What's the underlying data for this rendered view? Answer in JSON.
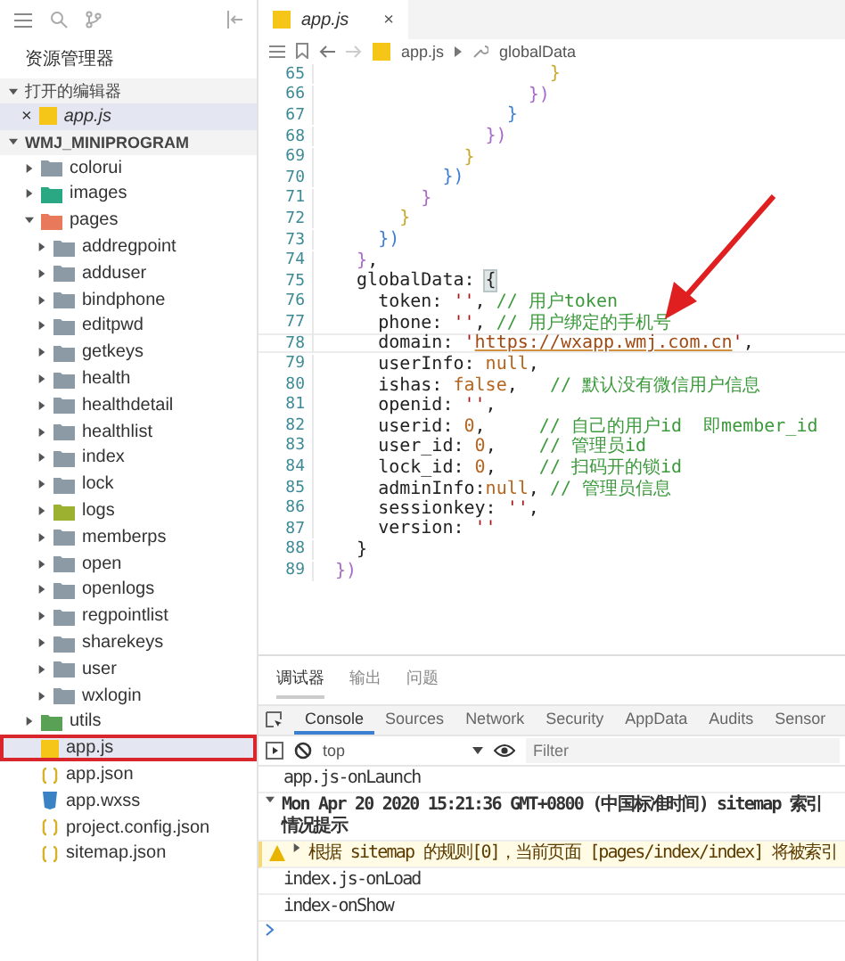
{
  "sidebar": {
    "title": "资源管理器",
    "open_editors": {
      "label": "打开的编辑器",
      "expanded": true,
      "items": [
        {
          "close": "×",
          "name": "app.js",
          "selected": true,
          "preview": true
        }
      ]
    },
    "project": {
      "label": "WMJ_MINIPROGRAM",
      "expanded": true,
      "items": [
        {
          "kind": "folder",
          "name": "colorui",
          "expanded": false
        },
        {
          "kind": "imagefolder",
          "name": "images",
          "expanded": false
        },
        {
          "kind": "pagefolder",
          "name": "pages",
          "expanded": true,
          "children": [
            {
              "kind": "folder",
              "name": "addregpoint",
              "expanded": false
            },
            {
              "kind": "folder",
              "name": "adduser",
              "expanded": false
            },
            {
              "kind": "folder",
              "name": "bindphone",
              "expanded": false
            },
            {
              "kind": "folder",
              "name": "editpwd",
              "expanded": false
            },
            {
              "kind": "folder",
              "name": "getkeys",
              "expanded": false
            },
            {
              "kind": "folder",
              "name": "health",
              "expanded": false
            },
            {
              "kind": "folder",
              "name": "healthdetail",
              "expanded": false
            },
            {
              "kind": "folder",
              "name": "healthlist",
              "expanded": false
            },
            {
              "kind": "folder",
              "name": "index",
              "expanded": false
            },
            {
              "kind": "folder",
              "name": "lock",
              "expanded": false
            },
            {
              "kind": "logfolder",
              "name": "logs",
              "expanded": false
            },
            {
              "kind": "folder",
              "name": "memberps",
              "expanded": false
            },
            {
              "kind": "folder",
              "name": "open",
              "expanded": false
            },
            {
              "kind": "folder",
              "name": "openlogs",
              "expanded": false
            },
            {
              "kind": "folder",
              "name": "regpointlist",
              "expanded": false
            },
            {
              "kind": "folder",
              "name": "sharekeys",
              "expanded": false
            },
            {
              "kind": "folder",
              "name": "user",
              "expanded": false
            },
            {
              "kind": "folder",
              "name": "wxlogin",
              "expanded": false
            }
          ]
        },
        {
          "kind": "utilfolder",
          "name": "utils",
          "expanded": false
        },
        {
          "kind": "jsfile",
          "name": "app.js",
          "selected": true,
          "annotated": true
        },
        {
          "kind": "jsonfile",
          "name": "app.json",
          "selected": false,
          "annotated": false
        },
        {
          "kind": "cssfile",
          "name": "app.wxss",
          "selected": false,
          "annotated": false
        },
        {
          "kind": "jsonfile",
          "name": "project.config.json",
          "selected": false,
          "annotated": false
        },
        {
          "kind": "jsonfile",
          "name": "sitemap.json",
          "selected": false,
          "annotated": false
        }
      ]
    }
  },
  "editor": {
    "tabs": [
      {
        "label": "app.js",
        "close": "×",
        "selected": true
      }
    ],
    "breadcrumb": [
      "app.js",
      "globalData"
    ],
    "lines": [
      {
        "number": "65",
        "current": false,
        "tokens": [
          {
            "kind": "b1",
            "text": "                    }"
          }
        ]
      },
      {
        "number": "66",
        "current": false,
        "tokens": [
          {
            "kind": "b2",
            "text": "                  })"
          }
        ]
      },
      {
        "number": "67",
        "current": false,
        "tokens": [
          {
            "kind": "b3",
            "text": "                }"
          }
        ]
      },
      {
        "number": "68",
        "current": false,
        "tokens": [
          {
            "kind": "b2",
            "text": "              })"
          }
        ]
      },
      {
        "number": "69",
        "current": false,
        "tokens": [
          {
            "kind": "b1",
            "text": "            }"
          }
        ]
      },
      {
        "number": "70",
        "current": false,
        "tokens": [
          {
            "kind": "b3",
            "text": "          })"
          }
        ]
      },
      {
        "number": "71",
        "current": false,
        "tokens": [
          {
            "kind": "b2",
            "text": "        }"
          }
        ]
      },
      {
        "number": "72",
        "current": false,
        "tokens": [
          {
            "kind": "b1",
            "text": "      }"
          }
        ]
      },
      {
        "number": "73",
        "current": false,
        "tokens": [
          {
            "kind": "b3",
            "text": "    })"
          }
        ]
      },
      {
        "number": "74",
        "current": false,
        "tokens": [
          {
            "kind": "b2",
            "text": "  }"
          },
          {
            "kind": "text",
            "text": ","
          }
        ]
      },
      {
        "number": "75",
        "current": false,
        "tokens": [
          {
            "kind": "text",
            "text": "  globalData: "
          },
          {
            "kind": "match",
            "text": "{"
          }
        ]
      },
      {
        "number": "76",
        "current": false,
        "tokens": [
          {
            "kind": "text",
            "text": "    token: "
          },
          {
            "kind": "string",
            "text": "''"
          },
          {
            "kind": "text",
            "text": ", "
          },
          {
            "kind": "comment",
            "text": "// 用户token"
          }
        ]
      },
      {
        "number": "77",
        "current": false,
        "tokens": [
          {
            "kind": "text",
            "text": "    phone: "
          },
          {
            "kind": "string",
            "text": "''"
          },
          {
            "kind": "text",
            "text": ", "
          },
          {
            "kind": "comment",
            "text": "// 用户绑定的手机号"
          }
        ]
      },
      {
        "number": "78",
        "current": true,
        "tokens": [
          {
            "kind": "text",
            "text": "    domain: "
          },
          {
            "kind": "string",
            "text": "'"
          },
          {
            "kind": "link",
            "text": "https://wxapp.wmj.com.cn"
          },
          {
            "kind": "string",
            "text": "'"
          },
          {
            "kind": "text",
            "text": ","
          }
        ]
      },
      {
        "number": "79",
        "current": false,
        "tokens": [
          {
            "kind": "text",
            "text": "    userInfo: "
          },
          {
            "kind": "value",
            "text": "null"
          },
          {
            "kind": "text",
            "text": ","
          }
        ]
      },
      {
        "number": "80",
        "current": false,
        "tokens": [
          {
            "kind": "text",
            "text": "    ishas: "
          },
          {
            "kind": "value",
            "text": "false"
          },
          {
            "kind": "text",
            "text": ",   "
          },
          {
            "kind": "comment",
            "text": "// 默认没有微信用户信息"
          }
        ]
      },
      {
        "number": "81",
        "current": false,
        "tokens": [
          {
            "kind": "text",
            "text": "    openid: "
          },
          {
            "kind": "string",
            "text": "''"
          },
          {
            "kind": "text",
            "text": ","
          }
        ]
      },
      {
        "number": "82",
        "current": false,
        "tokens": [
          {
            "kind": "text",
            "text": "    userid: "
          },
          {
            "kind": "value",
            "text": "0"
          },
          {
            "kind": "text",
            "text": ",     "
          },
          {
            "kind": "comment",
            "text": "// 自己的用户id  即member_id"
          }
        ]
      },
      {
        "number": "83",
        "current": false,
        "tokens": [
          {
            "kind": "text",
            "text": "    user_id: "
          },
          {
            "kind": "value",
            "text": "0"
          },
          {
            "kind": "text",
            "text": ",    "
          },
          {
            "kind": "comment",
            "text": "// 管理员id"
          }
        ]
      },
      {
        "number": "84",
        "current": false,
        "tokens": [
          {
            "kind": "text",
            "text": "    lock_id: "
          },
          {
            "kind": "value",
            "text": "0"
          },
          {
            "kind": "text",
            "text": ",    "
          },
          {
            "kind": "comment",
            "text": "// 扫码开的锁id"
          }
        ]
      },
      {
        "number": "85",
        "current": false,
        "tokens": [
          {
            "kind": "text",
            "text": "    adminInfo:"
          },
          {
            "kind": "value",
            "text": "null"
          },
          {
            "kind": "text",
            "text": ", "
          },
          {
            "kind": "comment",
            "text": "// 管理员信息"
          }
        ]
      },
      {
        "number": "86",
        "current": false,
        "tokens": [
          {
            "kind": "text",
            "text": "    sessionkey: "
          },
          {
            "kind": "string",
            "text": "''"
          },
          {
            "kind": "text",
            "text": ","
          }
        ]
      },
      {
        "number": "87",
        "current": false,
        "tokens": [
          {
            "kind": "text",
            "text": "    version: "
          },
          {
            "kind": "string",
            "text": "''"
          }
        ]
      },
      {
        "number": "88",
        "current": false,
        "tokens": [
          {
            "kind": "text",
            "text": "  }"
          }
        ]
      },
      {
        "number": "89",
        "current": false,
        "tokens": [
          {
            "kind": "b2",
            "text": "})"
          }
        ]
      }
    ]
  },
  "debugger": {
    "tabs": [
      {
        "label": "调试器",
        "selected": true
      },
      {
        "label": "输出",
        "selected": false
      },
      {
        "label": "问题",
        "selected": false
      }
    ],
    "devtools_tabs": [
      {
        "label": "Console",
        "selected": true
      },
      {
        "label": "Sources",
        "selected": false
      },
      {
        "label": "Network",
        "selected": false
      },
      {
        "label": "Security",
        "selected": false
      },
      {
        "label": "AppData",
        "selected": false
      },
      {
        "label": "Audits",
        "selected": false
      },
      {
        "label": "Sensor",
        "selected": false
      }
    ],
    "context": "top",
    "filter": {
      "placeholder": "Filter"
    },
    "messages": [
      {
        "kind": "log",
        "text": "app.js-onLaunch"
      },
      {
        "kind": "group",
        "expanded": true,
        "text": "Mon Apr 20 2020 15:21:36 GMT+0800 (中国标准时间) sitemap 索引情况提示"
      },
      {
        "kind": "warning",
        "expanded": false,
        "text": "根据 sitemap 的规则[0]，当前页面 [pages/index/index] 将被索引"
      },
      {
        "kind": "log",
        "text": "index.js-onLoad"
      },
      {
        "kind": "log",
        "text": "index-onShow"
      }
    ]
  }
}
